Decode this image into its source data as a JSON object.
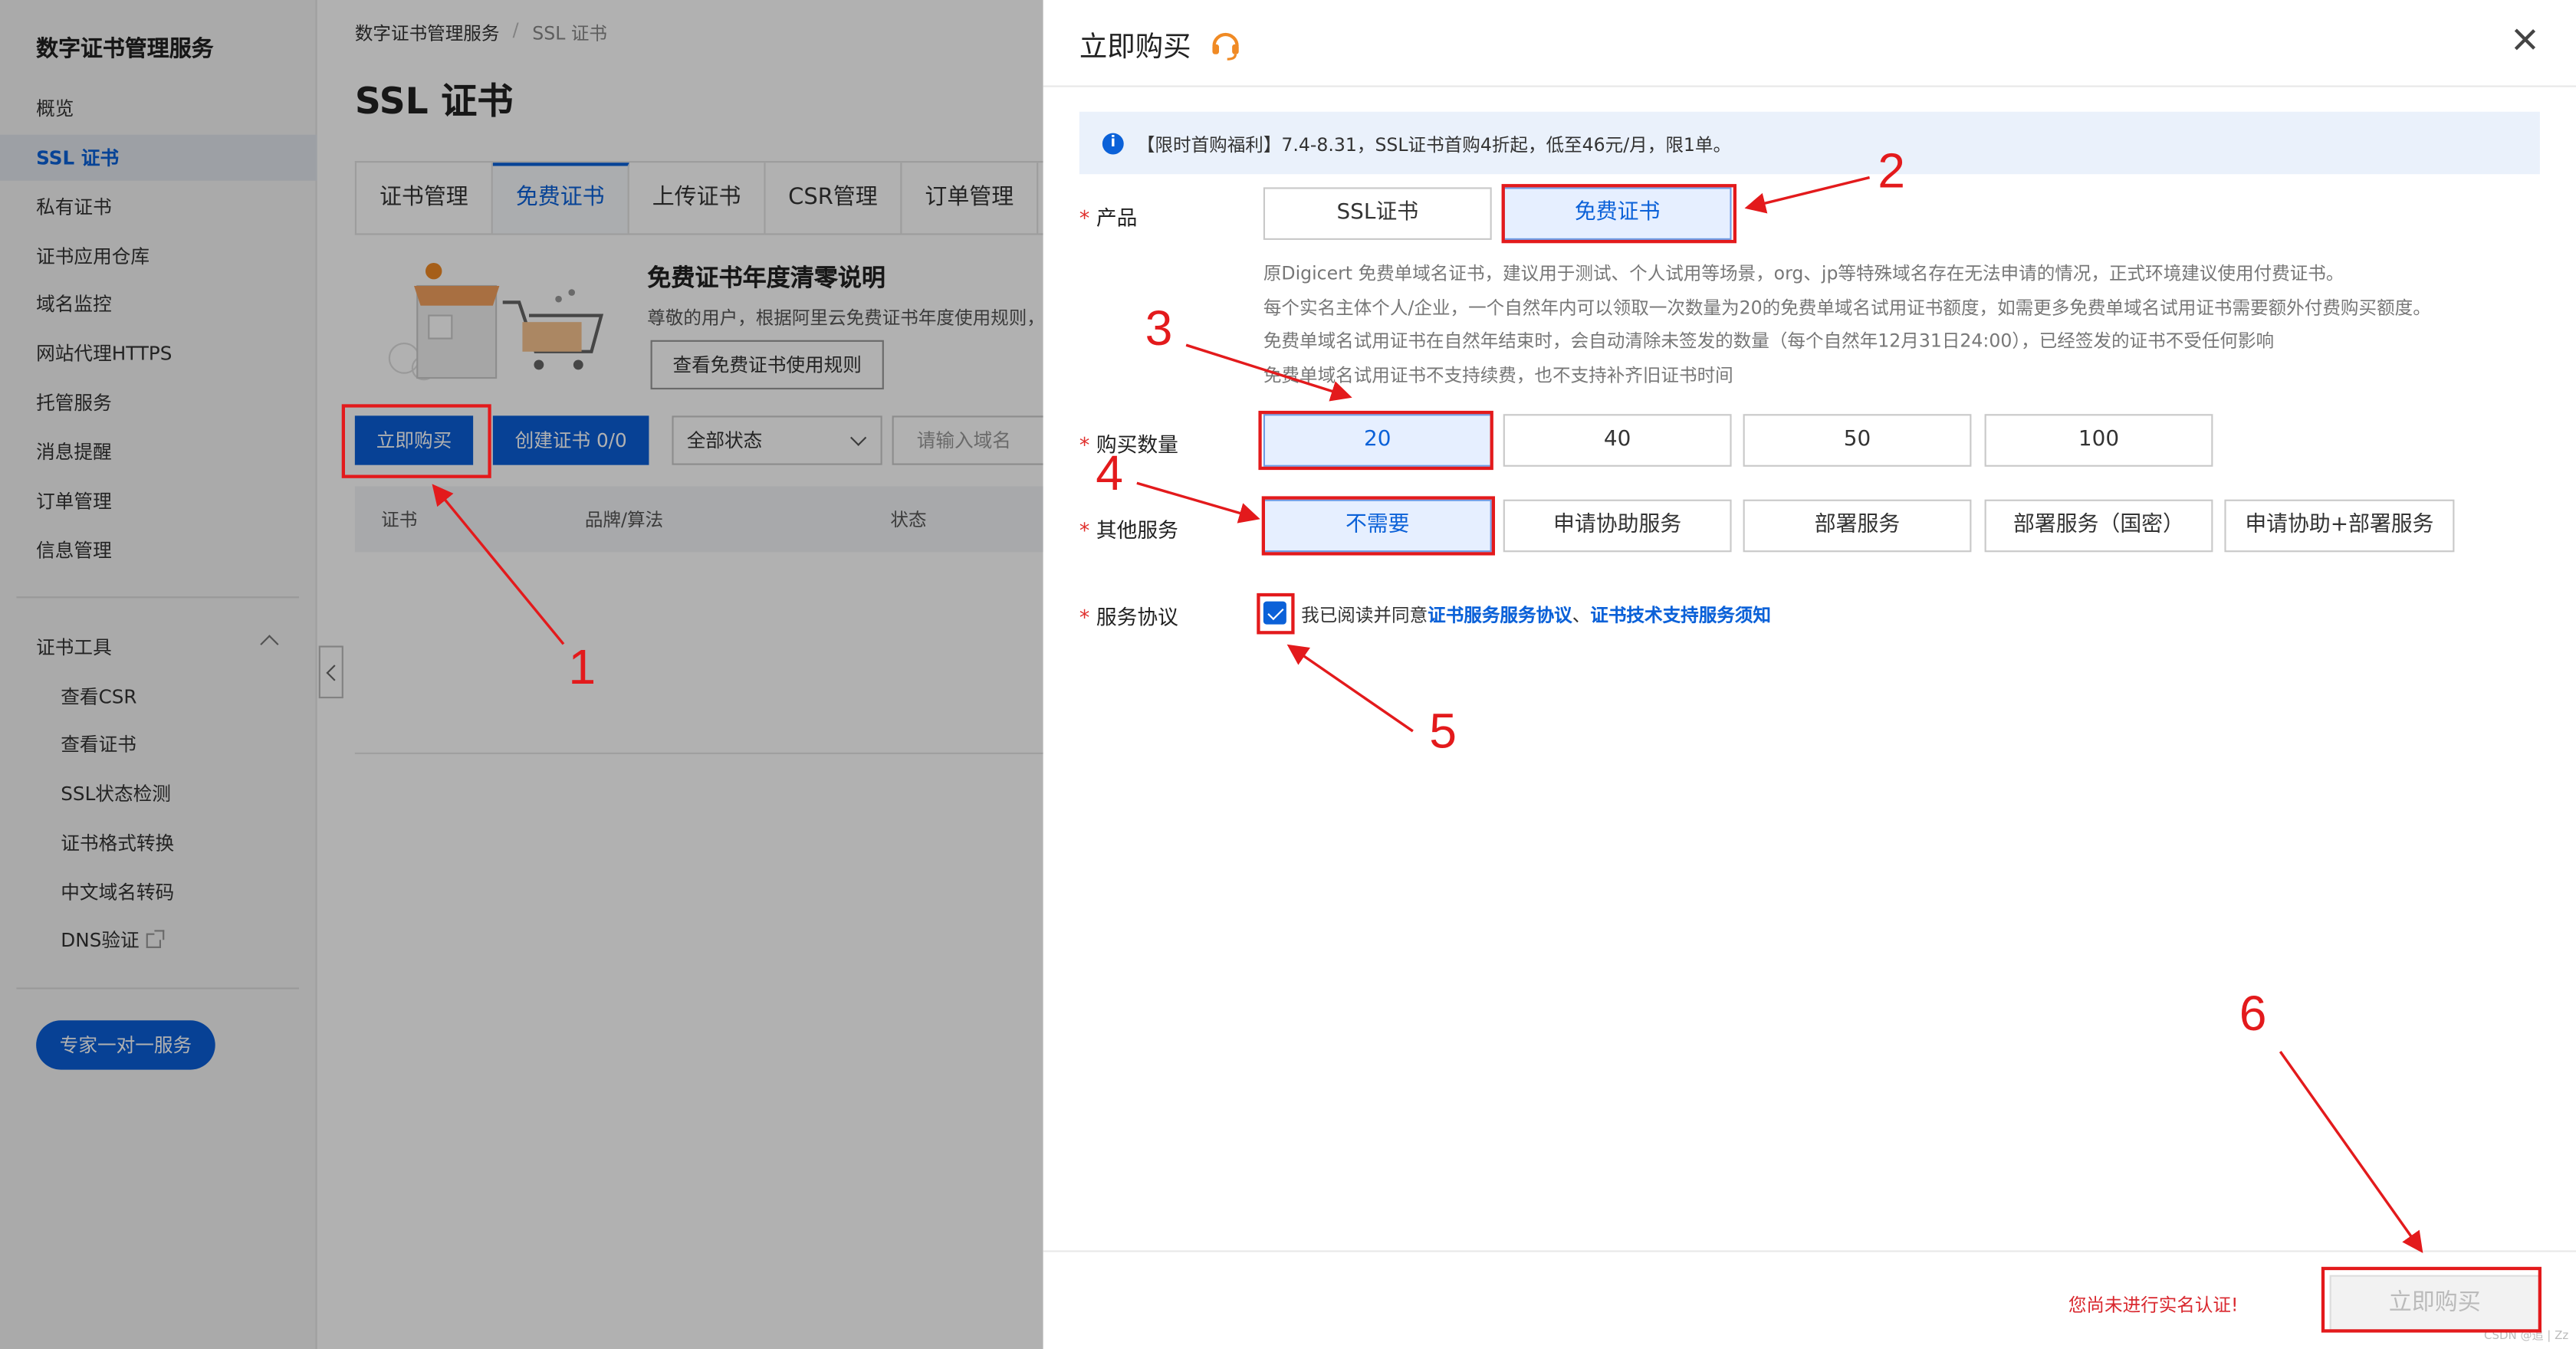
{
  "sidebar": {
    "title": "数字证书管理服务",
    "items": [
      "概览",
      "SSL 证书",
      "私有证书",
      "证书应用仓库",
      "域名监控",
      "网站代理HTTPS",
      "托管服务",
      "消息提醒",
      "订单管理",
      "信息管理"
    ],
    "tools_title": "证书工具",
    "tools": [
      "查看CSR",
      "查看证书",
      "SSL状态检测",
      "证书格式转换",
      "中文域名转码",
      "DNS验证"
    ],
    "expert_button": "专家一对一服务"
  },
  "main": {
    "breadcrumb": [
      "数字证书管理服务",
      "/",
      "SSL 证书"
    ],
    "page_title": "SSL 证书",
    "tabs": [
      "证书管理",
      "免费证书",
      "上传证书",
      "CSR管理",
      "订单管理"
    ],
    "free_title": "免费证书年度清零说明",
    "free_desc": "尊敬的用户，根据阿里云免费证书年度使用规则，",
    "rules_button": "查看免费证书使用规则",
    "buy_button": "立即购买",
    "create_button": "创建证书 0/0",
    "status_select": "全部状态",
    "domain_placeholder": "请输入域名",
    "table_headers": [
      "证书",
      "品牌/算法",
      "状态"
    ]
  },
  "drawer": {
    "title": "立即购买",
    "notice": "【限时首购福利】7.4-8.31，SSL证书首购4折起，低至46元/月，限1单。",
    "product_label": "产品",
    "product_options": [
      "SSL证书",
      "免费证书"
    ],
    "product_selected": "免费证书",
    "hints": [
      "原Digicert 免费单域名证书，建议用于测试、个人试用等场景，org、jp等特殊域名存在无法申请的情况，正式环境建议使用付费证书。",
      "每个实名主体个人/企业，一个自然年内可以领取一次数量为20的免费单域名试用证书额度，如需更多免费单域名试用证书需要额外付费购买额度。",
      "免费单域名试用证书在自然年结束时，会自动清除未签发的数量（每个自然年12月31日24:00），已经签发的证书不受任何影响",
      "免费单域名试用证书不支持续费，也不支持补齐旧证书时间"
    ],
    "quantity_label": "购买数量",
    "quantity_options": [
      "20",
      "40",
      "50",
      "100"
    ],
    "quantity_selected": "20",
    "service_label": "其他服务",
    "service_options": [
      "不需要",
      "申请协助服务",
      "部署服务",
      "部署服务（国密）",
      "申请协助+部署服务"
    ],
    "service_selected": "不需要",
    "agreement_label": "服务协议",
    "agreement_checked": true,
    "agreement_prefix": "我已阅读并同意",
    "agreement_link1": "证书服务服务协议",
    "agreement_sep": "、",
    "agreement_link2": "证书技术支持服务须知",
    "warning": "您尚未进行实名认证!",
    "submit": "立即购买",
    "watermark": "CSDN @追 | Zz"
  },
  "annotations": [
    "1",
    "2",
    "3",
    "4",
    "5",
    "6"
  ],
  "colors": {
    "primary": "#0b5ed7",
    "annotation": "#e31a1c",
    "warning": "#d9272e",
    "selected_bg": "#e6efff"
  }
}
